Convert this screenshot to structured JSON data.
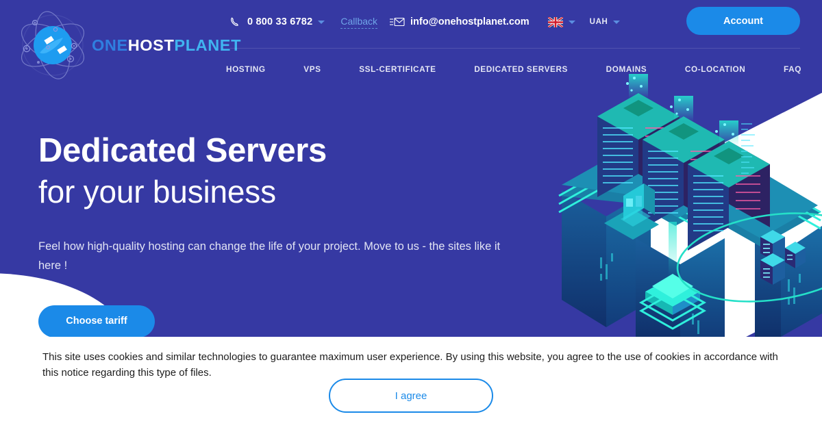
{
  "brand": {
    "logo_one": "ONE",
    "logo_host": "HOST",
    "logo_planet": "PLANET",
    "globe_icon": "globe-orbit-icon",
    "accent_blue": "#1b8ae8",
    "hero_background": "#3639a3",
    "logo_one_color": "#2f7fe0",
    "logo_planet_color": "#40b4f0"
  },
  "topbar": {
    "phone_icon": "phone-handset-icon",
    "phone": "0 800 33 6782",
    "phone_caret": "chevron-down-icon",
    "callback": "Callback",
    "mail_icon": "envelope-icon",
    "email": "info@onehostplanet.com",
    "flag_icon": "united-kingdom-flag-icon",
    "flag_caret": "chevron-down-icon",
    "currency": "UAH",
    "currency_caret": "chevron-down-icon",
    "account_label": "Account"
  },
  "nav": {
    "items": [
      {
        "label": "HOSTING"
      },
      {
        "label": "VPS"
      },
      {
        "label": "SSL-CERTIFICATE"
      },
      {
        "label": "DEDICATED SERVERS"
      },
      {
        "label": "DOMAINS"
      },
      {
        "label": "CO-LOCATION"
      },
      {
        "label": "FAQ"
      }
    ]
  },
  "hero": {
    "title_bold": "Dedicated Servers",
    "title_light": "for your business",
    "subtitle": "Feel how high-quality hosting can change the life of your project. Move to us - the sites like it here !",
    "cta_label": "Choose tariff",
    "illustration": "isometric-data-center-city-illustration"
  },
  "cookie": {
    "text": "This site uses cookies and similar technologies to guarantee maximum user experience. By using this website, you agree to the use of cookies in accordance with this notice regarding this type of files.",
    "agree_label": "I agree"
  }
}
